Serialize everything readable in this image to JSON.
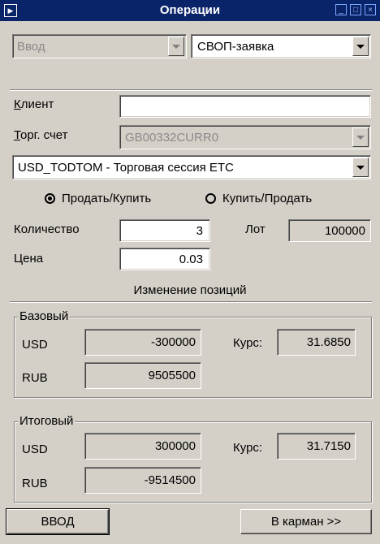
{
  "window": {
    "title": "Операции",
    "sys_icon": "app-menu-icon",
    "controls": [
      "minimize-icon",
      "maximize-icon",
      "close-icon"
    ]
  },
  "mode": {
    "value": "Ввод"
  },
  "order_type": {
    "value": "СВОП-заявка"
  },
  "client": {
    "label": "Клиент",
    "value": ""
  },
  "account": {
    "label": "Торг. счет",
    "value": "GB00332CURR0"
  },
  "instrument": {
    "value": "USD_TODTOM  - Торговая сессия ETC"
  },
  "direction": {
    "options": [
      {
        "label": "Продать/Купить",
        "selected": true
      },
      {
        "label": "Купить/Продать",
        "selected": false
      }
    ]
  },
  "quantity": {
    "label": "Количество",
    "value": "3"
  },
  "lot": {
    "label": "Лот",
    "value": "100000"
  },
  "price": {
    "label": "Цена",
    "value": "0.03"
  },
  "position_change": {
    "heading": "Изменение позиций"
  },
  "base": {
    "title": "Базовый",
    "usd_label": "USD",
    "usd_value": "-300000",
    "rub_label": "RUB",
    "rub_value": "9505500",
    "rate_label": "Курс:",
    "rate_value": "31.6850"
  },
  "total": {
    "title": "Итоговый",
    "usd_label": "USD",
    "usd_value": "300000",
    "rub_label": "RUB",
    "rub_value": "-9514500",
    "rate_label": "Курс:",
    "rate_value": "31.7150"
  },
  "buttons": {
    "enter": "ВВОД",
    "pocket": "В карман >>"
  }
}
